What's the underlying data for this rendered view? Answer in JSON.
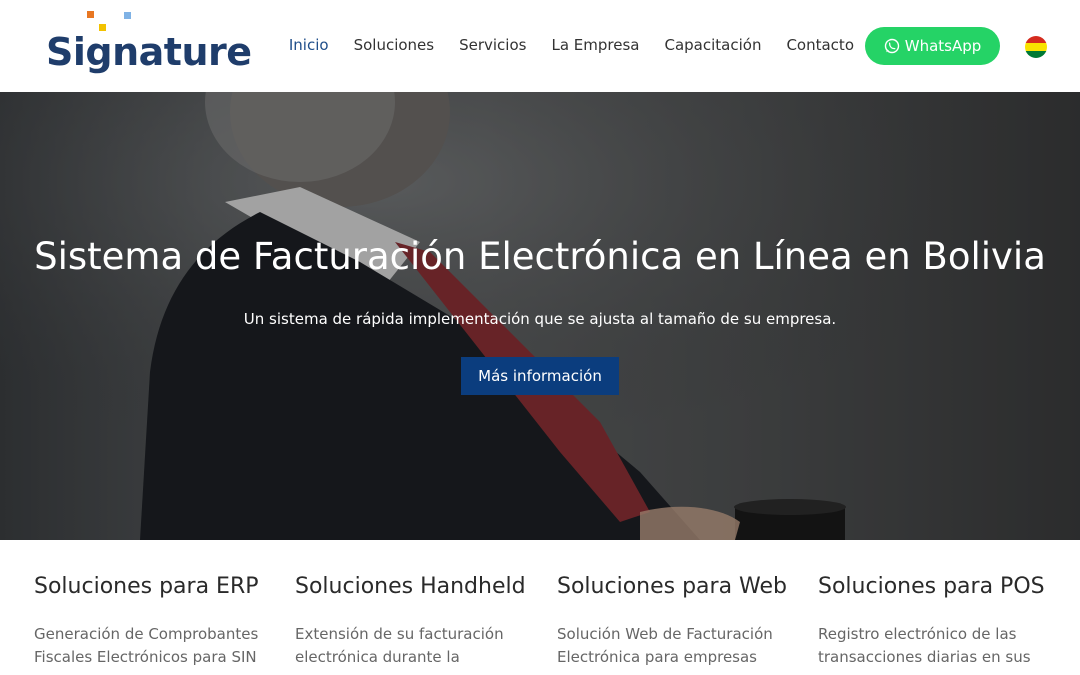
{
  "brand": {
    "logo_text": "Signature",
    "dot_colors": [
      "#e87722",
      "#f2c200",
      "#7fb2e5"
    ]
  },
  "nav": {
    "items": [
      {
        "label": "Inicio",
        "active": true
      },
      {
        "label": "Soluciones",
        "active": false
      },
      {
        "label": "Servicios",
        "active": false
      },
      {
        "label": "La Empresa",
        "active": false
      },
      {
        "label": "Capacitación",
        "active": false
      },
      {
        "label": "Contacto",
        "active": false
      }
    ],
    "whatsapp_label": "WhatsApp",
    "flag_icon": "bolivia-flag-icon",
    "flag_colors": [
      "#d52b1e",
      "#f9e300",
      "#007934"
    ]
  },
  "hero": {
    "title": "Sistema de Facturación Electrónica en Línea en Bolivia",
    "subtitle": "Un sistema de rápida implementación que se ajusta al tamaño de su empresa.",
    "cta_label": "Más información"
  },
  "features": [
    {
      "title": "Soluciones para ERP",
      "desc_1": "Generación de Comprobantes",
      "desc_2": "Fiscales Electrónicos para SIN"
    },
    {
      "title": "Soluciones Handheld",
      "desc_1": "Extensión de su facturación",
      "desc_2": "electrónica durante la"
    },
    {
      "title": "Soluciones para Web",
      "desc_1": "Solución Web de Facturación",
      "desc_2": "Electrónica para empresas"
    },
    {
      "title": "Soluciones para POS",
      "desc_1": "Registro electrónico de las",
      "desc_2": "transacciones diarias en sus"
    }
  ],
  "colors": {
    "accent": "#0b3d7e",
    "whatsapp": "#25d366",
    "logo_text": "#1f3d6b"
  }
}
